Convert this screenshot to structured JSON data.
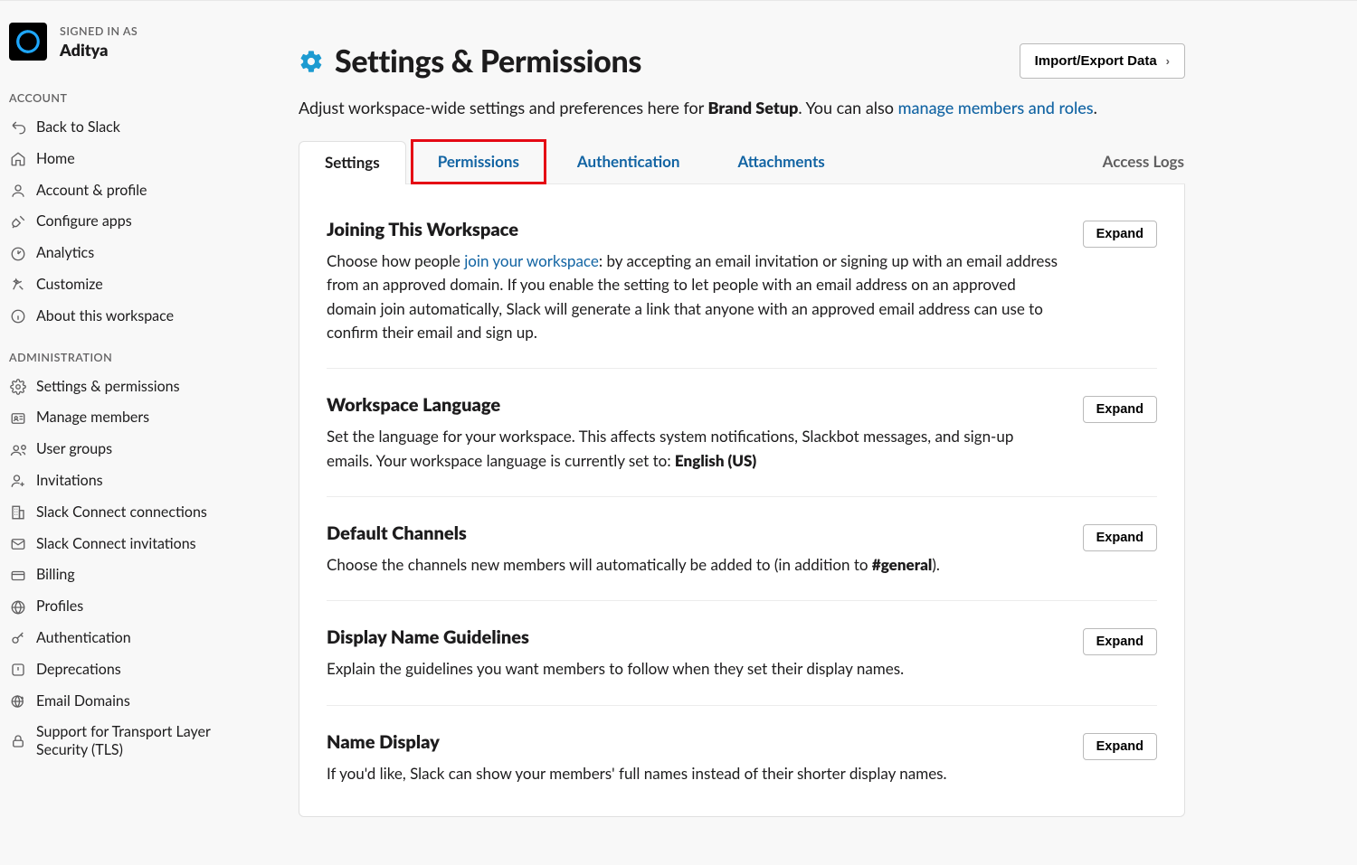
{
  "signed_in": {
    "label": "Signed in as",
    "name": "Aditya"
  },
  "sidebar": {
    "groups": [
      {
        "label": "Account",
        "items": [
          {
            "icon": "back-arrow-icon",
            "label": "Back to Slack"
          },
          {
            "icon": "home-icon",
            "label": "Home"
          },
          {
            "icon": "person-icon",
            "label": "Account & profile"
          },
          {
            "icon": "plug-icon",
            "label": "Configure apps"
          },
          {
            "icon": "gauge-icon",
            "label": "Analytics"
          },
          {
            "icon": "sparkle-icon",
            "label": "Customize"
          },
          {
            "icon": "info-icon",
            "label": "About this workspace"
          }
        ]
      },
      {
        "label": "Administration",
        "items": [
          {
            "icon": "gear-icon",
            "label": "Settings & permissions"
          },
          {
            "icon": "id-card-icon",
            "label": "Manage members"
          },
          {
            "icon": "people-icon",
            "label": "User groups"
          },
          {
            "icon": "person-plus-icon",
            "label": "Invitations"
          },
          {
            "icon": "building-icon",
            "label": "Slack Connect connections"
          },
          {
            "icon": "envelope-icon",
            "label": "Slack Connect invitations"
          },
          {
            "icon": "credit-card-icon",
            "label": "Billing"
          },
          {
            "icon": "globe-icon",
            "label": "Profiles"
          },
          {
            "icon": "key-icon",
            "label": "Authentication"
          },
          {
            "icon": "warning-square-icon",
            "label": "Deprecations"
          },
          {
            "icon": "globe-plus-icon",
            "label": "Email Domains"
          },
          {
            "icon": "lock-icon",
            "label": "Support for Transport Layer Security (TLS)"
          }
        ]
      }
    ]
  },
  "header": {
    "title": "Settings & Permissions",
    "import_button": "Import/Export Data",
    "subtitle_prefix": "Adjust workspace-wide settings and preferences here for ",
    "workspace_name": "Brand Setup",
    "subtitle_middle": ". You can also ",
    "manage_link": "manage members and roles",
    "subtitle_suffix": "."
  },
  "tabs": {
    "items": [
      {
        "label": "Settings",
        "active": true
      },
      {
        "label": "Permissions",
        "highlight": true
      },
      {
        "label": "Authentication"
      },
      {
        "label": "Attachments"
      }
    ],
    "access_logs": "Access Logs"
  },
  "sections": [
    {
      "title": "Joining This Workspace",
      "desc_pre": "Choose how people ",
      "link": "join your workspace",
      "desc_post": ": by accepting an email invitation or signing up with an email address from an approved domain. If you enable the setting to let people with an email address on an approved domain join automatically, Slack will generate a link that anyone with an approved email address can use to confirm their email and sign up.",
      "expand": "Expand"
    },
    {
      "title": "Workspace Language",
      "desc_pre": "Set the language for your workspace. This affects system notifications, Slackbot messages, and sign-up emails. Your workspace language is currently set to: ",
      "bold": "English (US)",
      "expand": "Expand"
    },
    {
      "title": "Default Channels",
      "desc_pre": "Choose the channels new members will automatically be added to (in addition to ",
      "bold": "#general",
      "desc_post": ").",
      "expand": "Expand"
    },
    {
      "title": "Display Name Guidelines",
      "desc_pre": "Explain the guidelines you want members to follow when they set their display names.",
      "expand": "Expand"
    },
    {
      "title": "Name Display",
      "desc_pre": "If you'd like, Slack can show your members' full names instead of their shorter display names.",
      "expand": "Expand"
    }
  ]
}
